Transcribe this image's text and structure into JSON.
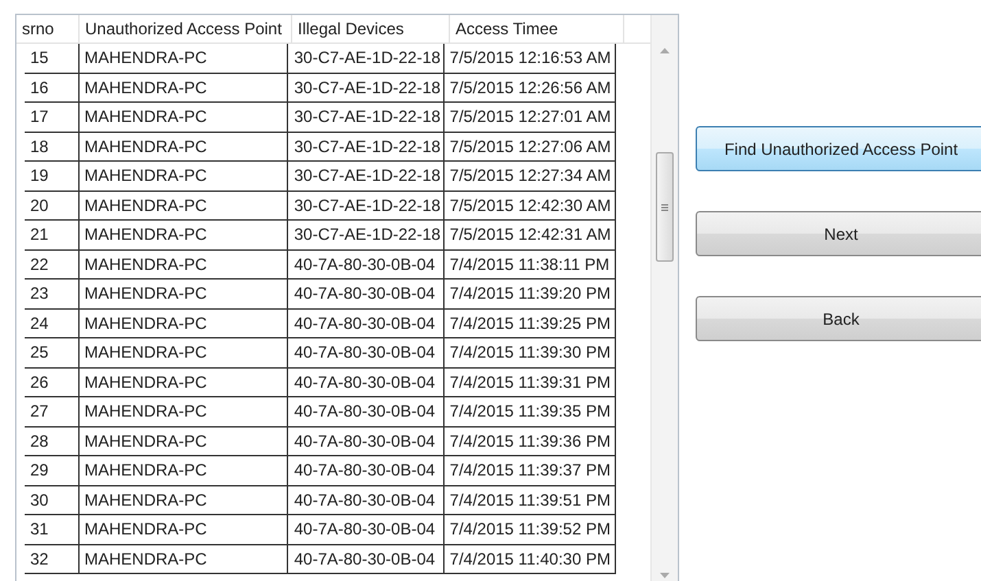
{
  "table": {
    "columns": [
      "srno",
      "Unauthorized Access Point",
      "Illegal Devices",
      "Access Timee"
    ],
    "rows": [
      [
        "15",
        "MAHENDRA-PC",
        "30-C7-AE-1D-22-18",
        "7/5/2015 12:16:53 AM"
      ],
      [
        "16",
        "MAHENDRA-PC",
        "30-C7-AE-1D-22-18",
        "7/5/2015 12:26:56 AM"
      ],
      [
        "17",
        "MAHENDRA-PC",
        "30-C7-AE-1D-22-18",
        "7/5/2015 12:27:01 AM"
      ],
      [
        "18",
        "MAHENDRA-PC",
        "30-C7-AE-1D-22-18",
        "7/5/2015 12:27:06 AM"
      ],
      [
        "19",
        "MAHENDRA-PC",
        "30-C7-AE-1D-22-18",
        "7/5/2015 12:27:34 AM"
      ],
      [
        "20",
        "MAHENDRA-PC",
        "30-C7-AE-1D-22-18",
        "7/5/2015 12:42:30 AM"
      ],
      [
        "21",
        "MAHENDRA-PC",
        "30-C7-AE-1D-22-18",
        "7/5/2015 12:42:31 AM"
      ],
      [
        "22",
        "MAHENDRA-PC",
        "40-7A-80-30-0B-04",
        "7/4/2015 11:38:11 PM"
      ],
      [
        "23",
        "MAHENDRA-PC",
        "40-7A-80-30-0B-04",
        "7/4/2015 11:39:20 PM"
      ],
      [
        "24",
        "MAHENDRA-PC",
        "40-7A-80-30-0B-04",
        "7/4/2015 11:39:25 PM"
      ],
      [
        "25",
        "MAHENDRA-PC",
        "40-7A-80-30-0B-04",
        "7/4/2015 11:39:30 PM"
      ],
      [
        "26",
        "MAHENDRA-PC",
        "40-7A-80-30-0B-04",
        "7/4/2015 11:39:31 PM"
      ],
      [
        "27",
        "MAHENDRA-PC",
        "40-7A-80-30-0B-04",
        "7/4/2015 11:39:35 PM"
      ],
      [
        "28",
        "MAHENDRA-PC",
        "40-7A-80-30-0B-04",
        "7/4/2015 11:39:36 PM"
      ],
      [
        "29",
        "MAHENDRA-PC",
        "40-7A-80-30-0B-04",
        "7/4/2015 11:39:37 PM"
      ],
      [
        "30",
        "MAHENDRA-PC",
        "40-7A-80-30-0B-04",
        "7/4/2015 11:39:51 PM"
      ],
      [
        "31",
        "MAHENDRA-PC",
        "40-7A-80-30-0B-04",
        "7/4/2015 11:39:52 PM"
      ],
      [
        "32",
        "MAHENDRA-PC",
        "40-7A-80-30-0B-04",
        "7/4/2015 11:40:30 PM"
      ]
    ]
  },
  "buttons": [
    {
      "label": "Find Unauthorized Access Point",
      "focused": true
    },
    {
      "label": "Next",
      "focused": false
    },
    {
      "label": "Back",
      "focused": false
    }
  ]
}
